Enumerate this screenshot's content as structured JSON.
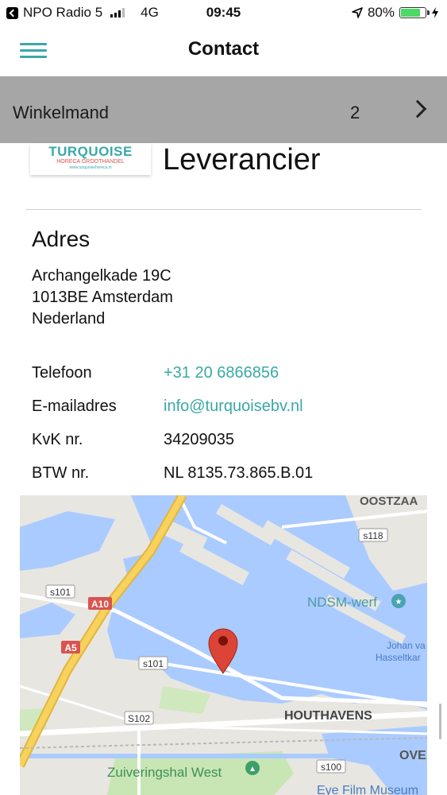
{
  "status_bar": {
    "carrier": "NPO Radio 5",
    "network": "4G",
    "time": "09:45",
    "battery": "80%",
    "battery_level": 0.8
  },
  "header": {
    "title": "Contact"
  },
  "cart": {
    "label": "Winkelmand",
    "count": "2"
  },
  "supplier": {
    "title": "Leverancier",
    "logo": {
      "brand": "TURQUOISE",
      "sub": "HORECA GROOTHANDEL",
      "url": "www.turquoisehoreca.nl"
    }
  },
  "address": {
    "heading": "Adres",
    "line1": "Archangelkade 19C",
    "line2": "1013BE Amsterdam",
    "line3": "Nederland"
  },
  "details": {
    "phone_label": "Telefoon",
    "phone_value": "+31 20 6866856",
    "email_label": "E-mailadres",
    "email_value": "info@turquoisebv.nl",
    "kvk_label": "KvK nr.",
    "kvk_value": "34209035",
    "btw_label": "BTW nr.",
    "btw_value": "NL 8135.73.865.B.01"
  },
  "map": {
    "labels": {
      "oostzaan": "OOSTZAA",
      "s118": "s118",
      "s101_a": "s101",
      "a10": "A10",
      "ndsm": "NDSM-werf",
      "a5": "A5",
      "johan": "Johan va",
      "hasselt": "Hasseltkar",
      "s101_b": "s101",
      "s102": "S102",
      "houthavens": "HOUTHAVENS",
      "ove": "OVE",
      "zuiveringshal": "Zuiveringshal West",
      "s100": "s100",
      "eye": "Eye Film Museum"
    },
    "colors": {
      "water": "#aacbff",
      "land": "#e8e6e1",
      "park": "#c8e6b4",
      "highway": "#f7d25c",
      "marker": "#db4437"
    }
  },
  "colors": {
    "accent": "#3aa8a8",
    "cart_bar": "#a6a6a6"
  }
}
